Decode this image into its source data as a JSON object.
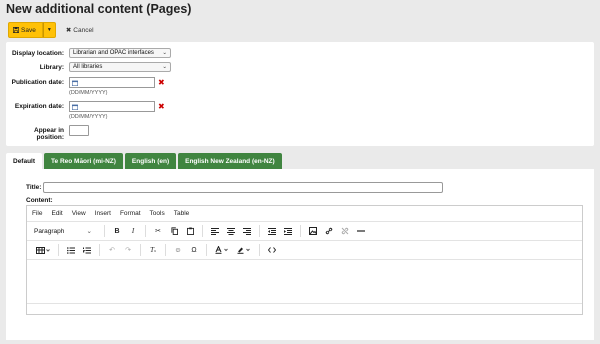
{
  "page_title": "New additional content (Pages)",
  "toolbar": {
    "save_label": "Save",
    "cancel_label": "Cancel"
  },
  "form": {
    "display_location": {
      "label": "Display location:",
      "value": "Librarian and OPAC interfaces"
    },
    "library": {
      "label": "Library:",
      "value": "All libraries"
    },
    "publication_date": {
      "label": "Publication date:",
      "value": "",
      "hint": "(DD/MM/YYYY)"
    },
    "expiration_date": {
      "label": "Expiration date:",
      "value": "",
      "hint": "(DD/MM/YYYY)"
    },
    "position": {
      "label": "Appear in position:",
      "value": ""
    }
  },
  "tabs": [
    {
      "label": "Default",
      "active": true
    },
    {
      "label": "Te Reo Māori (mi-NZ)"
    },
    {
      "label": "English (en)"
    },
    {
      "label": "English New Zealand (en-NZ)"
    }
  ],
  "editor": {
    "title_label": "Title:",
    "title_value": "",
    "content_label": "Content:",
    "menu": [
      "File",
      "Edit",
      "View",
      "Insert",
      "Format",
      "Tools",
      "Table"
    ],
    "block_format": "Paragraph"
  },
  "colors": {
    "save_button": "#ffc107",
    "tab_green": "#408540",
    "clear_red": "#cc0000"
  }
}
